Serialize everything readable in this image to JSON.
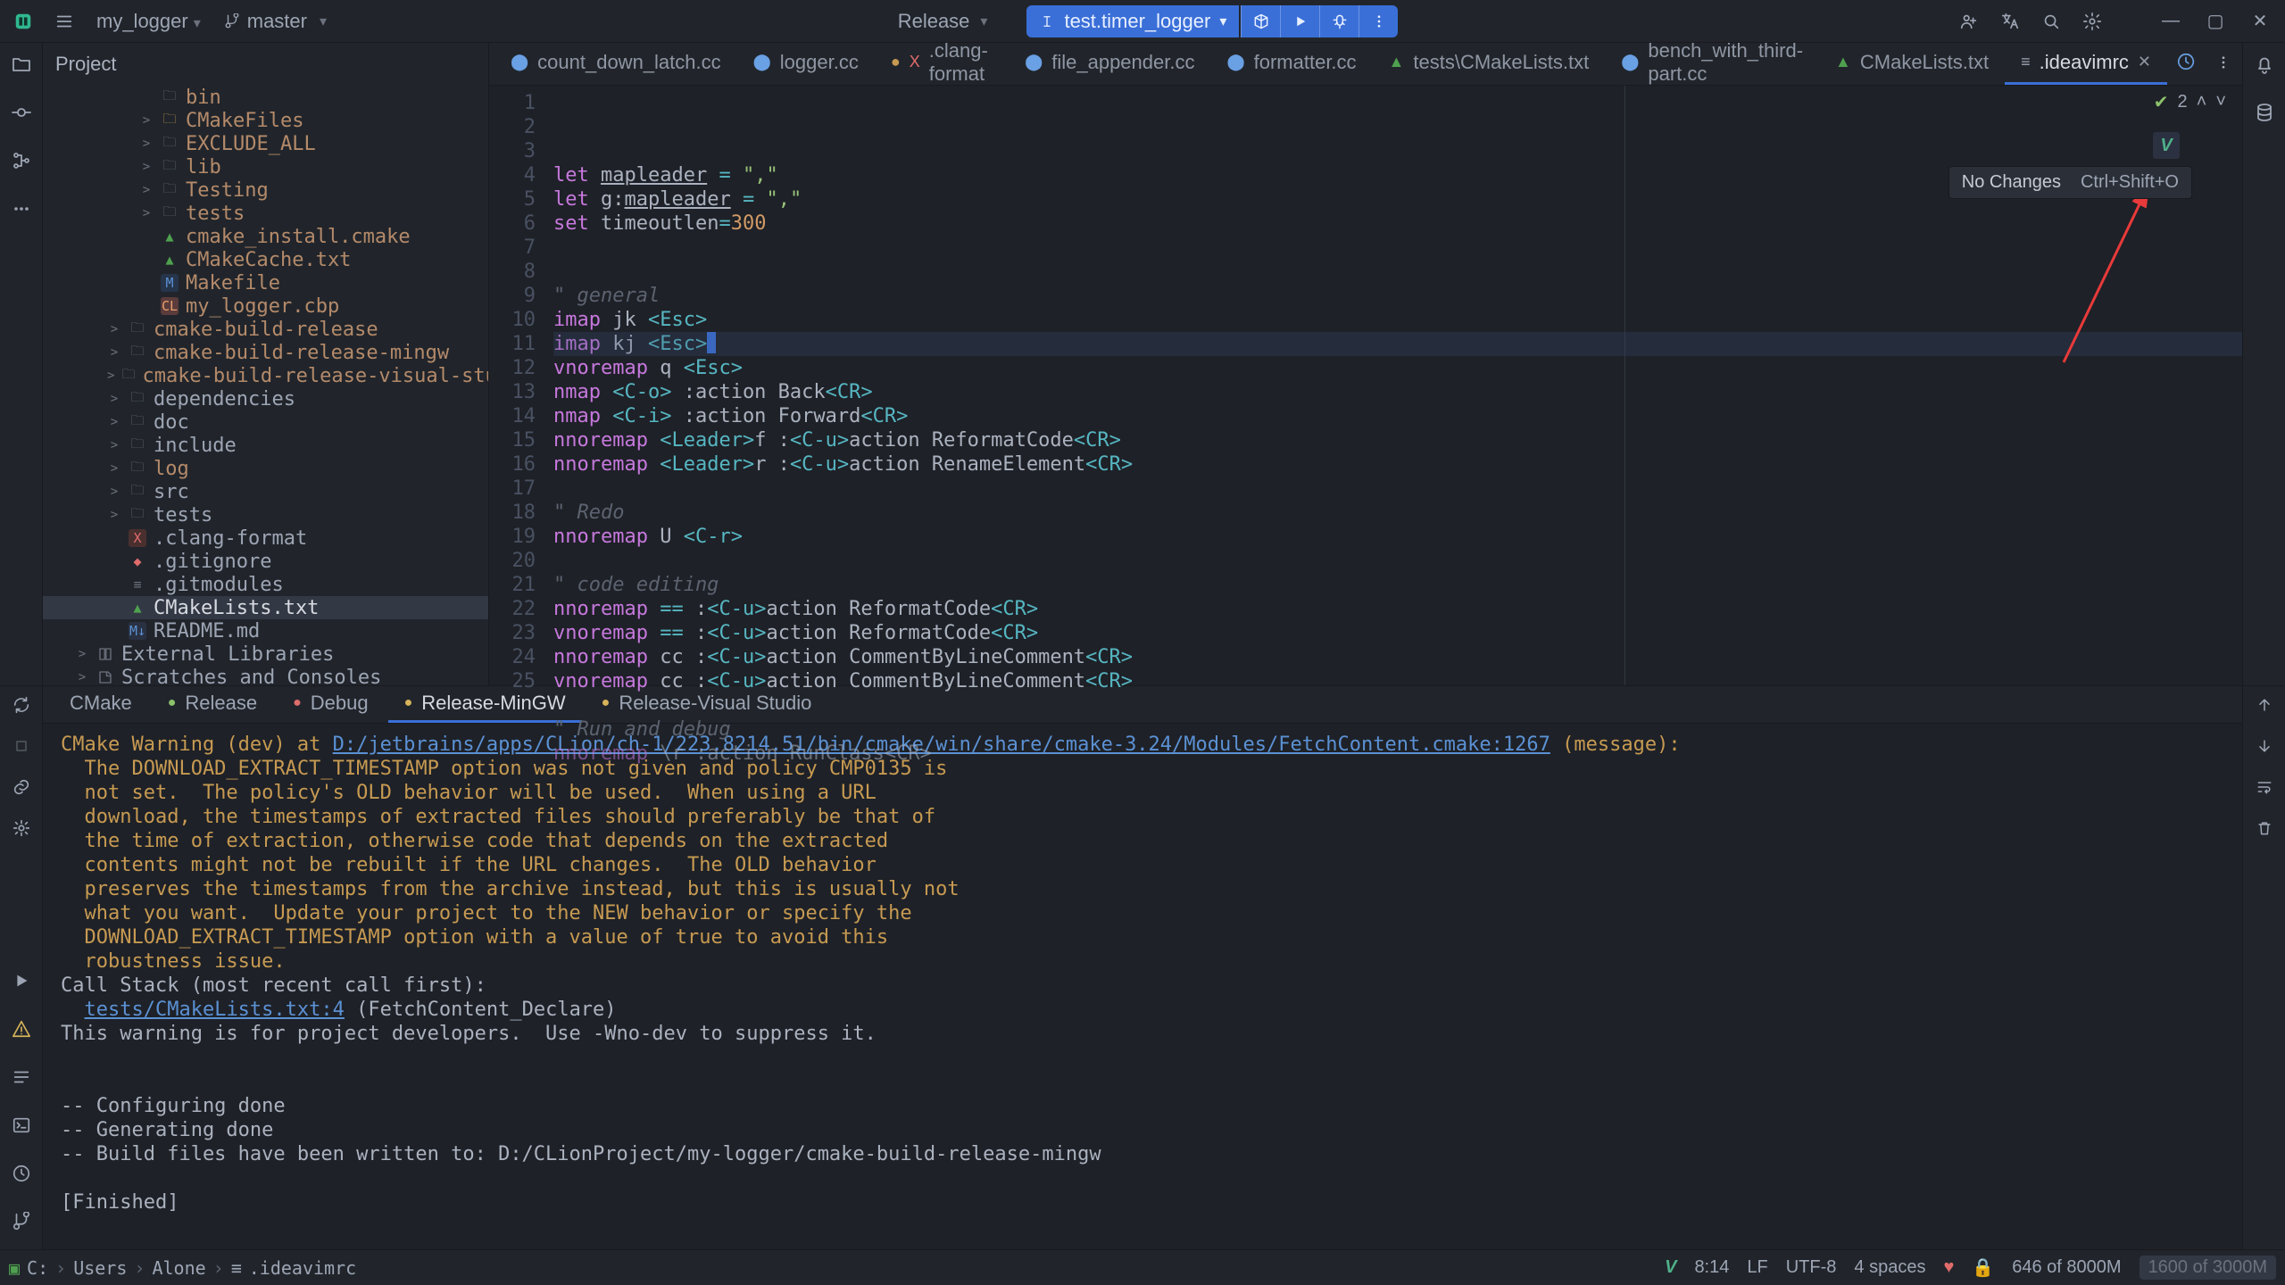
{
  "titlebar": {
    "project": "my_logger",
    "branch": "master",
    "build_config": "Release",
    "run_target": "test.timer_logger"
  },
  "project_panel": {
    "title": "Project",
    "tree": [
      {
        "depth": 5,
        "arrow": "",
        "icon": "fi-dir",
        "label": "bin",
        "cls": "brown"
      },
      {
        "depth": 5,
        "arrow": ">",
        "icon": "fi-dir-a",
        "label": "CMakeFiles",
        "cls": "brown"
      },
      {
        "depth": 5,
        "arrow": ">",
        "icon": "fi-dir",
        "label": "EXCLUDE_ALL",
        "cls": "brown"
      },
      {
        "depth": 5,
        "arrow": ">",
        "icon": "fi-dir",
        "label": "lib",
        "cls": "brown"
      },
      {
        "depth": 5,
        "arrow": ">",
        "icon": "fi-dir",
        "label": "Testing",
        "cls": "brown"
      },
      {
        "depth": 5,
        "arrow": ">",
        "icon": "fi-dir",
        "label": "tests",
        "cls": "brown"
      },
      {
        "depth": 5,
        "arrow": "",
        "icon": "fi-cmake",
        "label": "cmake_install.cmake",
        "cls": "brown"
      },
      {
        "depth": 5,
        "arrow": "",
        "icon": "fi-cmake",
        "label": "CMakeCache.txt",
        "cls": "brown"
      },
      {
        "depth": 5,
        "arrow": "",
        "icon": "fi-m",
        "label": "Makefile",
        "cls": "brown"
      },
      {
        "depth": 5,
        "arrow": "",
        "icon": "fi-cl",
        "label": "my_logger.cbp",
        "cls": "brown"
      },
      {
        "depth": 3,
        "arrow": ">",
        "icon": "fi-dir",
        "label": "cmake-build-release",
        "cls": "brown"
      },
      {
        "depth": 3,
        "arrow": ">",
        "icon": "fi-dir",
        "label": "cmake-build-release-mingw",
        "cls": "brown"
      },
      {
        "depth": 3,
        "arrow": ">",
        "icon": "fi-dir",
        "label": "cmake-build-release-visual-studio",
        "cls": "brown"
      },
      {
        "depth": 3,
        "arrow": ">",
        "icon": "fi-dir",
        "label": "dependencies",
        "cls": ""
      },
      {
        "depth": 3,
        "arrow": ">",
        "icon": "fi-dir",
        "label": "doc",
        "cls": ""
      },
      {
        "depth": 3,
        "arrow": ">",
        "icon": "fi-dir",
        "label": "include",
        "cls": ""
      },
      {
        "depth": 3,
        "arrow": ">",
        "icon": "fi-dir",
        "label": "log",
        "cls": "brown"
      },
      {
        "depth": 3,
        "arrow": ">",
        "icon": "fi-dir",
        "label": "src",
        "cls": ""
      },
      {
        "depth": 3,
        "arrow": ">",
        "icon": "fi-dir",
        "label": "tests",
        "cls": ""
      },
      {
        "depth": 3,
        "arrow": "",
        "icon": "fi-x",
        "label": ".clang-format",
        "cls": ""
      },
      {
        "depth": 3,
        "arrow": "",
        "icon": "fi-git",
        "label": ".gitignore",
        "cls": ""
      },
      {
        "depth": 3,
        "arrow": "",
        "icon": "fi-txt",
        "label": ".gitmodules",
        "cls": ""
      },
      {
        "depth": 3,
        "arrow": "",
        "icon": "fi-cmake",
        "label": "CMakeLists.txt",
        "cls": "",
        "selected": true
      },
      {
        "depth": 3,
        "arrow": "",
        "icon": "fi-md",
        "label": "README.md",
        "cls": ""
      },
      {
        "depth": 1,
        "arrow": ">",
        "icon": "fi-dir",
        "label": "External Libraries",
        "cls": "",
        "lib": true
      },
      {
        "depth": 1,
        "arrow": ">",
        "icon": "fi-dir",
        "label": "Scratches and Consoles",
        "cls": "",
        "scratch": true
      }
    ]
  },
  "tabs": [
    {
      "icon": "ic-cpp",
      "label": "count_down_latch.cc"
    },
    {
      "icon": "ic-cpp",
      "label": "logger.cc"
    },
    {
      "icon": "ic-clang",
      "label": ".clang-format",
      "dirty": true
    },
    {
      "icon": "ic-cpp",
      "label": "file_appender.cc"
    },
    {
      "icon": "ic-cpp",
      "label": "formatter.cc"
    },
    {
      "icon": "ic-cmake",
      "label": "tests\\CMakeLists.txt"
    },
    {
      "icon": "ic-cpp",
      "label": "bench_with_third-part.cc"
    },
    {
      "icon": "ic-cmake",
      "label": "CMakeLists.txt"
    },
    {
      "icon": "ic-lines",
      "label": ".ideavimrc",
      "active": true,
      "closable": true
    }
  ],
  "editor": {
    "widget_count": "2",
    "tooltip": {
      "label": "No Changes",
      "shortcut": "Ctrl+Shift+O"
    },
    "lines": [
      {
        "n": 1,
        "html": "<span class='kw'>let</span> <span class='gvar'>mapleader</span> <span class='op'>=</span> <span class='str'>\",\"</span>"
      },
      {
        "n": 2,
        "html": "<span class='kw'>let</span> <span class='fn'>g:</span><span class='gvar'>mapleader</span> <span class='op'>=</span> <span class='str'>\",\"</span>"
      },
      {
        "n": 3,
        "html": "<span class='kw'>set</span> <span class='fn'>timeoutlen</span><span class='op'>=</span><span class='num'>300</span>"
      },
      {
        "n": 4,
        "html": ""
      },
      {
        "n": 5,
        "html": ""
      },
      {
        "n": 6,
        "html": "<span class='com'>\" general</span>"
      },
      {
        "n": 7,
        "html": "<span class='kw'>imap</span> jk <span class='op'>&lt;Esc&gt;</span>"
      },
      {
        "n": 8,
        "html": "<span class='kw'>imap</span> kj <span class='op'>&lt;Esc&gt;</span><span class='caret'></span>",
        "hl": true
      },
      {
        "n": 9,
        "html": "<span class='kw'>vnoremap</span> q <span class='op'>&lt;Esc&gt;</span>"
      },
      {
        "n": 10,
        "html": "<span class='kw'>nmap</span> <span class='op'>&lt;C-o&gt;</span> :action Back<span class='op'>&lt;CR&gt;</span>"
      },
      {
        "n": 11,
        "html": "<span class='kw'>nmap</span> <span class='op'>&lt;C-i&gt;</span> :action Forward<span class='op'>&lt;CR&gt;</span>"
      },
      {
        "n": 12,
        "html": "<span class='kw'>nnoremap</span> <span class='op'>&lt;Leader&gt;</span>f :<span class='op'>&lt;C-u&gt;</span>action ReformatCode<span class='op'>&lt;CR&gt;</span>"
      },
      {
        "n": 13,
        "html": "<span class='kw'>nnoremap</span> <span class='op'>&lt;Leader&gt;</span>r :<span class='op'>&lt;C-u&gt;</span>action RenameElement<span class='op'>&lt;CR&gt;</span>"
      },
      {
        "n": 14,
        "html": ""
      },
      {
        "n": 15,
        "html": "<span class='com'>\" Redo</span>"
      },
      {
        "n": 16,
        "html": "<span class='kw'>nnoremap</span> U <span class='op'>&lt;C-r&gt;</span>"
      },
      {
        "n": 17,
        "html": ""
      },
      {
        "n": 18,
        "html": "<span class='com'>\" code editing</span>"
      },
      {
        "n": 19,
        "html": "<span class='kw'>nnoremap</span> <span class='op'>==</span> :<span class='op'>&lt;C-u&gt;</span>action ReformatCode<span class='op'>&lt;CR&gt;</span>"
      },
      {
        "n": 20,
        "html": "<span class='kw'>vnoremap</span> <span class='op'>==</span> :<span class='op'>&lt;C-u&gt;</span>action ReformatCode<span class='op'>&lt;CR&gt;</span>"
      },
      {
        "n": 21,
        "html": "<span class='kw'>nnoremap</span> cc :<span class='op'>&lt;C-u&gt;</span>action CommentByLineComment<span class='op'>&lt;CR&gt;</span>"
      },
      {
        "n": 22,
        "html": "<span class='kw'>vnoremap</span> cc :<span class='op'>&lt;C-u&gt;</span>action CommentByLineComment<span class='op'>&lt;CR&gt;</span>"
      },
      {
        "n": 23,
        "html": ""
      },
      {
        "n": 24,
        "html": "<span class='com'>\" Run and debug</span>"
      },
      {
        "n": 25,
        "html": "<span class='kw' style='opacity:.55'>nnoremap</span> <span style='opacity:.55'>\\r :action RunClass&lt;CR&gt;</span>"
      }
    ]
  },
  "tool_window": {
    "tabs": [
      {
        "label": "CMake"
      },
      {
        "label": "Release",
        "dot": "dot-g"
      },
      {
        "label": "Debug",
        "dot": "dot-r"
      },
      {
        "label": "Release-MinGW",
        "dot": "dot-y",
        "active": true
      },
      {
        "label": "Release-Visual Studio",
        "dot": "dot-y"
      }
    ],
    "lines": [
      {
        "html": "<span class='warn'>CMake Warning (dev) at </span><span class='link'>D:/jetbrains/apps/CLion/ch-1/223.8214.51/bin/cmake/win/share/cmake-3.24/Modules/FetchContent.cmake:1267</span><span class='warn'> (message):</span>"
      },
      {
        "html": "<span class='warn'>  The DOWNLOAD_EXTRACT_TIMESTAMP option was not given and policy CMP0135 is</span>"
      },
      {
        "html": "<span class='warn'>  not set.  The policy's OLD behavior will be used.  When using a URL</span>"
      },
      {
        "html": "<span class='warn'>  download, the timestamps of extracted files should preferably be that of</span>"
      },
      {
        "html": "<span class='warn'>  the time of extraction, otherwise code that depends on the extracted</span>"
      },
      {
        "html": "<span class='warn'>  contents might not be rebuilt if the URL changes.  The OLD behavior</span>"
      },
      {
        "html": "<span class='warn'>  preserves the timestamps from the archive instead, but this is usually not</span>"
      },
      {
        "html": "<span class='warn'>  what you want.  Update your project to the NEW behavior or specify the</span>"
      },
      {
        "html": "<span class='warn'>  DOWNLOAD_EXTRACT_TIMESTAMP option with a value of true to avoid this</span>"
      },
      {
        "html": "<span class='warn'>  robustness issue.</span>"
      },
      {
        "html": "Call Stack (most recent call first):"
      },
      {
        "html": "  <span class='link'>tests/CMakeLists.txt:4</span> (FetchContent_Declare)"
      },
      {
        "html": "This warning is for project developers.  Use -Wno-dev to suppress it."
      },
      {
        "html": ""
      },
      {
        "html": ""
      },
      {
        "html": "-- Configuring done"
      },
      {
        "html": "-- Generating done"
      },
      {
        "html": "-- Build files have been written to: D:/CLionProject/my-logger/cmake-build-release-mingw"
      },
      {
        "html": ""
      },
      {
        "html": "[Finished]"
      }
    ]
  },
  "statusbar": {
    "crumbs": [
      "C:",
      "Users",
      "Alone",
      ".ideavimrc"
    ],
    "pos": "8:14",
    "eol": "LF",
    "enc": "UTF-8",
    "indent": "4 spaces",
    "counter": "646 of 8000M",
    "pill": "1600 of 3000M"
  }
}
